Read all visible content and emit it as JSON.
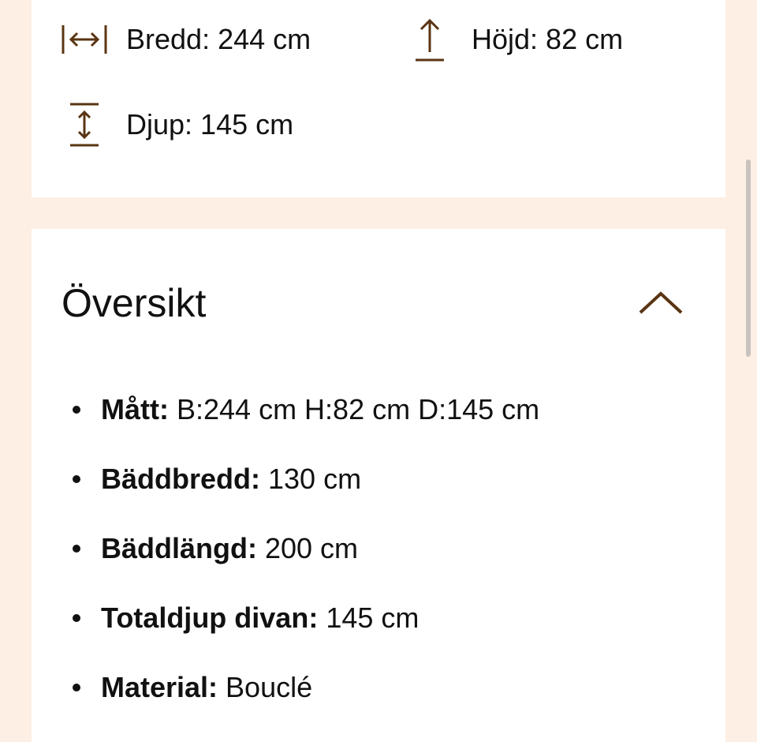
{
  "colors": {
    "background": "#fdefe4",
    "card": "#ffffff",
    "accent_icon": "#5a3413",
    "text": "#111111"
  },
  "dimensions": {
    "width": {
      "icon": "width-arrows-icon",
      "text": "Bredd: 244 cm"
    },
    "height": {
      "icon": "height-arrow-up-icon",
      "text": "Höjd: 82 cm"
    },
    "depth": {
      "icon": "depth-arrows-icon",
      "text": "Djup: 145 cm"
    }
  },
  "overview": {
    "title": "Översikt",
    "toggle_icon": "chevron-up-icon",
    "items": [
      {
        "label": "Mått:",
        "value": " B:244 cm H:82 cm D:145 cm"
      },
      {
        "label": "Bäddbredd:",
        "value": " 130 cm"
      },
      {
        "label": "Bäddlängd:",
        "value": " 200 cm"
      },
      {
        "label": "Totaldjup divan:",
        "value": " 145 cm"
      },
      {
        "label": "Material:",
        "value": " Bouclé"
      }
    ]
  }
}
